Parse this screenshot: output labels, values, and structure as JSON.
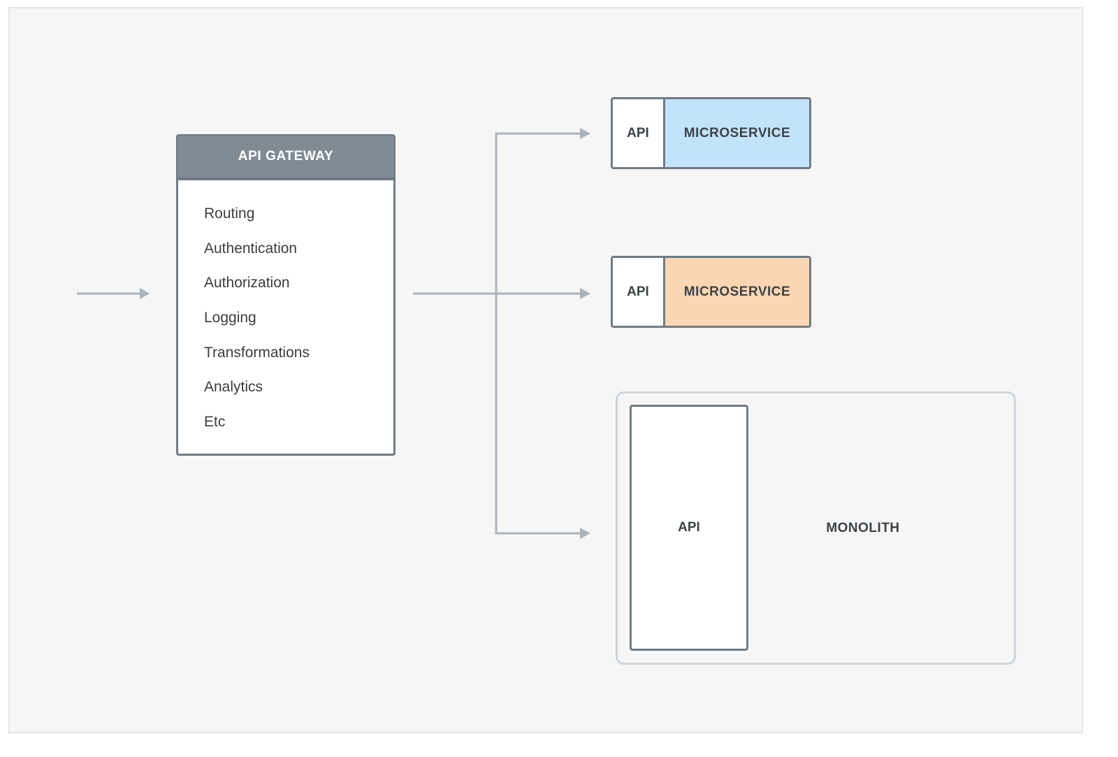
{
  "diagram": {
    "gateway": {
      "title": "API GATEWAY",
      "features": [
        "Routing",
        "Authentication",
        "Authorization",
        "Logging",
        "Transformations",
        "Analytics",
        "Etc"
      ]
    },
    "services": [
      {
        "api_label": "API",
        "name": "MICROSERVICE",
        "color": "#c2e4fb"
      },
      {
        "api_label": "API",
        "name": "MICROSERVICE",
        "color": "#fcd6b3"
      }
    ],
    "monolith": {
      "api_label": "API",
      "name": "MONOLITH"
    },
    "colors": {
      "background": "#f6f6f6",
      "header": "#808b94",
      "border": "#6f7b85",
      "arrow": "#a9b4bd",
      "monolith_border": "#cfd5db",
      "text": "#3b4248"
    },
    "edges": [
      {
        "from": "client",
        "to": "gateway"
      },
      {
        "from": "gateway",
        "to": "service-1"
      },
      {
        "from": "gateway",
        "to": "service-2"
      },
      {
        "from": "gateway",
        "to": "monolith"
      }
    ]
  }
}
